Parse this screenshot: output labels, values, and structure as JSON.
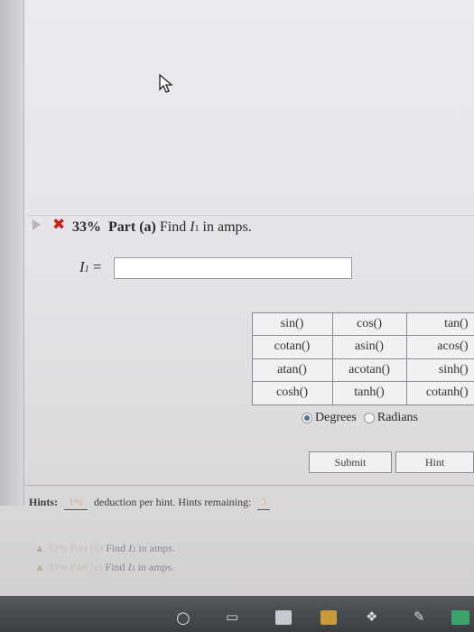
{
  "question": {
    "percent": "33%",
    "part": "Part (a)",
    "prompt_pre": "Find ",
    "prompt_var": "I",
    "prompt_sub": "1",
    "prompt_post": " in amps."
  },
  "answer": {
    "label_var": "I",
    "label_sub": "1",
    "label_eq": " =",
    "value": ""
  },
  "functions": [
    "sin()",
    "cos()",
    "tan()",
    "cotan()",
    "asin()",
    "acos()",
    "atan()",
    "acotan()",
    "sinh()",
    "cosh()",
    "tanh()",
    "cotanh()"
  ],
  "units": {
    "degrees": "Degrees",
    "radians": "Radians",
    "selected": "Degrees"
  },
  "buttons": {
    "submit": "Submit",
    "hint": "Hint"
  },
  "hints": {
    "label": "Hints:",
    "deduction_value": "1%",
    "deduction_text": "deduction per hint. Hints remaining:",
    "remaining_value": "3"
  },
  "other_parts": [
    {
      "percent": "33%",
      "part": "Part (b)",
      "find": "Find ",
      "var": "I",
      "sub": "2",
      "post": " in amps."
    },
    {
      "percent": "33%",
      "part": "Part (c)",
      "find": "Find ",
      "var": "I",
      "sub": "3",
      "post": " in amps."
    }
  ],
  "icons": {
    "cursor": "mouse-pointer-icon",
    "status": "x-mark-icon",
    "expand": "play-triangle-icon",
    "warning": "warning-triangle-icon"
  },
  "colors": {
    "status_red": "#c61f1f",
    "hint_value": "#d7b48a"
  }
}
